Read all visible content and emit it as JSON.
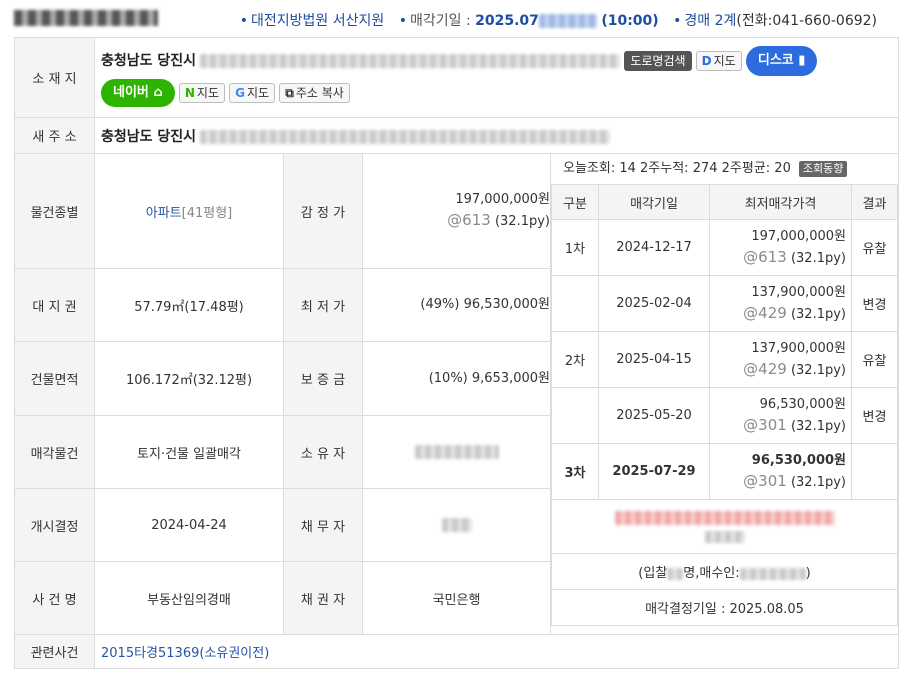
{
  "header": {
    "court": "대전지방법원 서산지원",
    "sale_date_label": "매각기일 :",
    "sale_date": "2025.07",
    "sale_time": "(10:00)",
    "dept": "경매 2계",
    "phone": "(전화:041-660-0692)"
  },
  "location": {
    "label": "소 재 지",
    "address": "충청남도 당진시",
    "road_search_btn": "도로명검색",
    "d_map_btn": "지도",
    "disco_btn": "디스코",
    "naver_btn": "네이버",
    "naver_map_btn": "지도",
    "google_map_btn": "지도",
    "copy_btn": "주소 복사"
  },
  "new_address": {
    "label": "새 주 소",
    "address": "충청남도 당진시"
  },
  "rows": [
    {
      "label": "물건종별",
      "value": "아파트",
      "value_extra": "[41평형]",
      "label2": "감 정 가",
      "amount": "197,000,000원",
      "at": "@613",
      "py": "(32.1py)"
    },
    {
      "label": "대 지 권",
      "value": "57.79㎡(17.48평)",
      "label2": "최 저 가",
      "amount": "(49%) 96,530,000원"
    },
    {
      "label": "건물면적",
      "value": "106.172㎡(32.12평)",
      "label2": "보 증 금",
      "amount": "(10%) 9,653,000원"
    },
    {
      "label": "매각물건",
      "value": "토지·건물 일괄매각",
      "label2": "소 유 자"
    },
    {
      "label": "개시결정",
      "value": "2024-04-24",
      "label2": "채 무 자"
    },
    {
      "label": "사 건 명",
      "value": "부동산임의경매",
      "label2": "채 권 자",
      "amount": "국민은행"
    }
  ],
  "related": {
    "label": "관련사건",
    "value": "2015타경51369(소유권이전)"
  },
  "stats": {
    "text": "오늘조회: 14  2주누적: 274  2주평균: 20",
    "badge": "조회동향"
  },
  "history": {
    "headers": [
      "구분",
      "매각기일",
      "최저매각가격",
      "결과"
    ],
    "rows": [
      {
        "round": "1차",
        "date": "2024-12-17",
        "price": "197,000,000원",
        "at": "@613",
        "py": "(32.1py)",
        "result": "유찰"
      },
      {
        "round": "",
        "date": "2025-02-04",
        "price": "137,900,000원",
        "at": "@429",
        "py": "(32.1py)",
        "result": "변경"
      },
      {
        "round": "2차",
        "date": "2025-04-15",
        "price": "137,900,000원",
        "at": "@429",
        "py": "(32.1py)",
        "result": "유찰"
      },
      {
        "round": "",
        "date": "2025-05-20",
        "price": "96,530,000원",
        "at": "@301",
        "py": "(32.1py)",
        "result": "변경"
      },
      {
        "round": "3차",
        "date": "2025-07-29",
        "price": "96,530,000원",
        "at": "@301",
        "py": "(32.1py)",
        "result": ""
      }
    ],
    "bidders_prefix": "(입찰",
    "bidders_mid": "명,매수인:",
    "bidders_suffix": ")",
    "decision": "매각결정기일 : 2025.08.05"
  }
}
